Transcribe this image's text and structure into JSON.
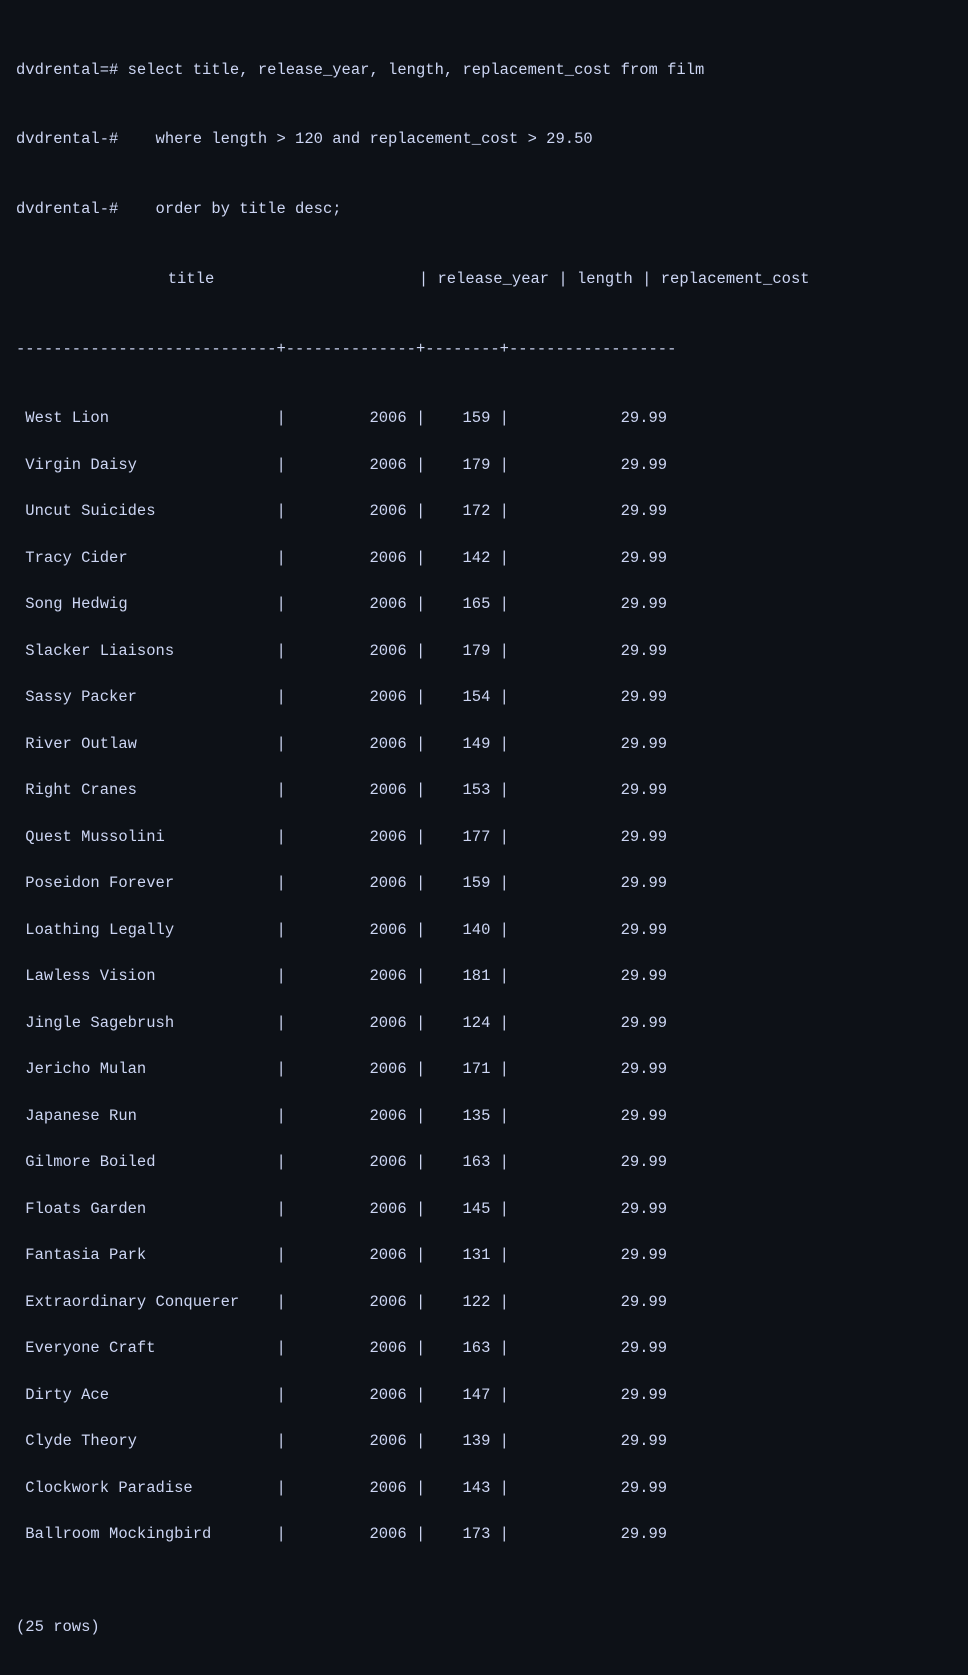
{
  "terminal": {
    "prompt1": "dvdrental=# select title, release_year, length, replacement_cost from film",
    "prompt2": "dvdrental-#    where length > 120 and replacement_cost > 29.50",
    "prompt3": "dvdrental-#    order by title desc;",
    "header": " title                      | release_year | length | replacement_cost",
    "separator": "----------------------------+--------------+--------+------------------",
    "rows": [
      " West Lion                  |         2006 |    159 |            29.99",
      " Virgin Daisy               |         2006 |    179 |            29.99",
      " Uncut Suicides             |         2006 |    172 |            29.99",
      " Tracy Cider                |         2006 |    142 |            29.99",
      " Song Hedwig                |         2006 |    165 |            29.99",
      " Slacker Liaisons           |         2006 |    179 |            29.99",
      " Sassy Packer               |         2006 |    154 |            29.99",
      " River Outlaw               |         2006 |    149 |            29.99",
      " Right Cranes               |         2006 |    153 |            29.99",
      " Quest Mussolini            |         2006 |    177 |            29.99",
      " Poseidon Forever           |         2006 |    159 |            29.99",
      " Loathing Legally           |         2006 |    140 |            29.99",
      " Lawless Vision             |         2006 |    181 |            29.99",
      " Jingle Sagebrush           |         2006 |    124 |            29.99",
      " Jericho Mulan              |         2006 |    171 |            29.99",
      " Japanese Run               |         2006 |    135 |            29.99",
      " Gilmore Boiled             |         2006 |    163 |            29.99",
      " Floats Garden              |         2006 |    145 |            29.99",
      " Fantasia Park              |         2006 |    131 |            29.99",
      " Extraordinary Conquerer    |         2006 |    122 |            29.99",
      " Everyone Craft             |         2006 |    163 |            29.99",
      " Dirty Ace                  |         2006 |    147 |            29.99",
      " Clyde Theory               |         2006 |    139 |            29.99",
      " Clockwork Paradise         |         2006 |    143 |            29.99",
      " Ballroom Mockingbird       |         2006 |    173 |            29.99"
    ],
    "footer": "(25 rows)"
  }
}
